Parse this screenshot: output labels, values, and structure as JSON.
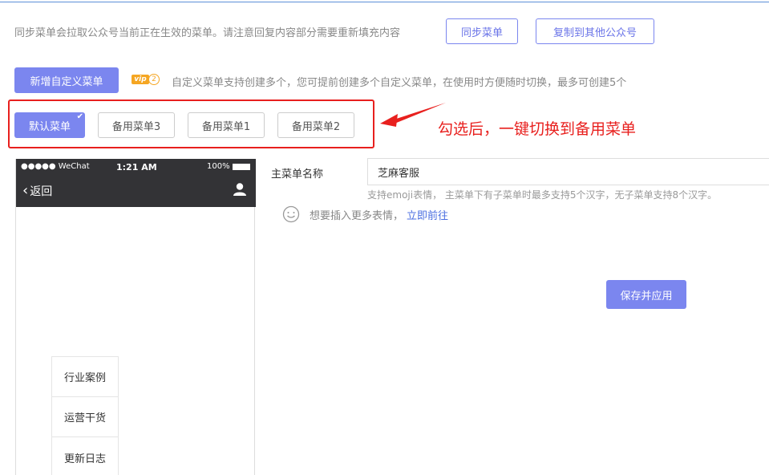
{
  "notice": {
    "text": "同步菜单会拉取公众号当前正在生效的菜单。请注意回复内容部分需要重新填充内容"
  },
  "toolbar": {
    "sync_label": "同步菜单",
    "copy_label": "复制到其他公众号",
    "add_label": "新增自定义菜单"
  },
  "vip": {
    "tag": "vip",
    "level": "2"
  },
  "add_description": "自定义菜单支持创建多个，您可提前创建多个自定义菜单，在使用时方便随时切换，最多可创建5个",
  "menu_tabs": [
    {
      "label": "默认菜单",
      "active": true,
      "check": "✔"
    },
    {
      "label": "备用菜单3"
    },
    {
      "label": "备用菜单1"
    },
    {
      "label": "备用菜单2"
    }
  ],
  "annotation": "勾选后，一键切换到备用菜单",
  "phone": {
    "carrier": "●●●●● WeChat",
    "time": "1:21 AM",
    "battery": "100%",
    "back_label": "返回",
    "back_chevron": "‹",
    "submenu": [
      "行业案例",
      "运营干货",
      "更新日志"
    ]
  },
  "form": {
    "name_label": "主菜单名称",
    "name_value": "芝麻客服",
    "hint": "支持emoji表情， 主菜单下有子菜单时最多支持5个汉字，无子菜单支持8个汉字。",
    "emoji_text": "想要插入更多表情，",
    "emoji_link": "立即前往",
    "save_label": "保存并应用"
  },
  "colors": {
    "accent": "#7b86ef",
    "annotation": "#e8201e",
    "link": "#4a6ee0"
  }
}
